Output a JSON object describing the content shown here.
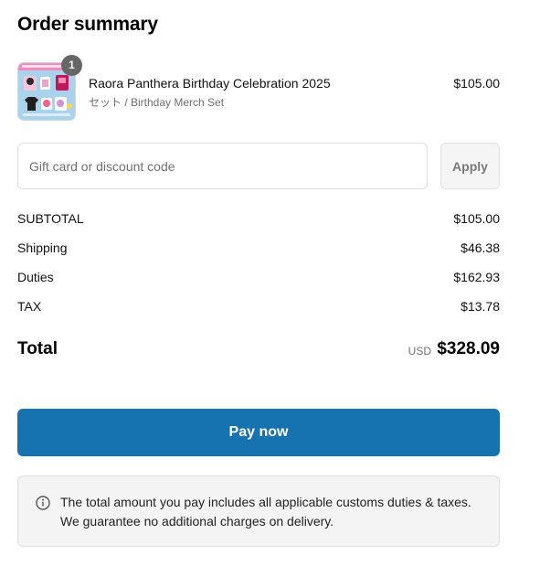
{
  "header": {
    "title": "Order summary"
  },
  "line_item": {
    "quantity": "1",
    "name": "Raora Panthera Birthday Celebration 2025",
    "variant": "セット / Birthday Merch Set",
    "price": "$105.00",
    "thumbnail_icon": "product-thumbnail"
  },
  "discount": {
    "placeholder": "Gift card or discount code",
    "value": "",
    "apply_label": "Apply"
  },
  "summary": {
    "subtotal_label": "SUBTOTAL",
    "subtotal_value": "$105.00",
    "shipping_label": "Shipping",
    "shipping_value": "$46.38",
    "duties_label": "Duties",
    "duties_value": "$162.93",
    "tax_label": "TAX",
    "tax_value": "$13.78"
  },
  "total": {
    "label": "Total",
    "currency": "USD",
    "amount": "$328.09"
  },
  "pay": {
    "label": "Pay now"
  },
  "notice": {
    "icon": "info-icon",
    "line1": "The total amount you pay includes all applicable customs duties & taxes.",
    "line2": "We guarantee no additional charges on delivery."
  },
  "colors": {
    "accent": "#1773b0",
    "badge": "#666666",
    "notice_bg": "#f4f4f4",
    "muted_text": "#707070"
  }
}
